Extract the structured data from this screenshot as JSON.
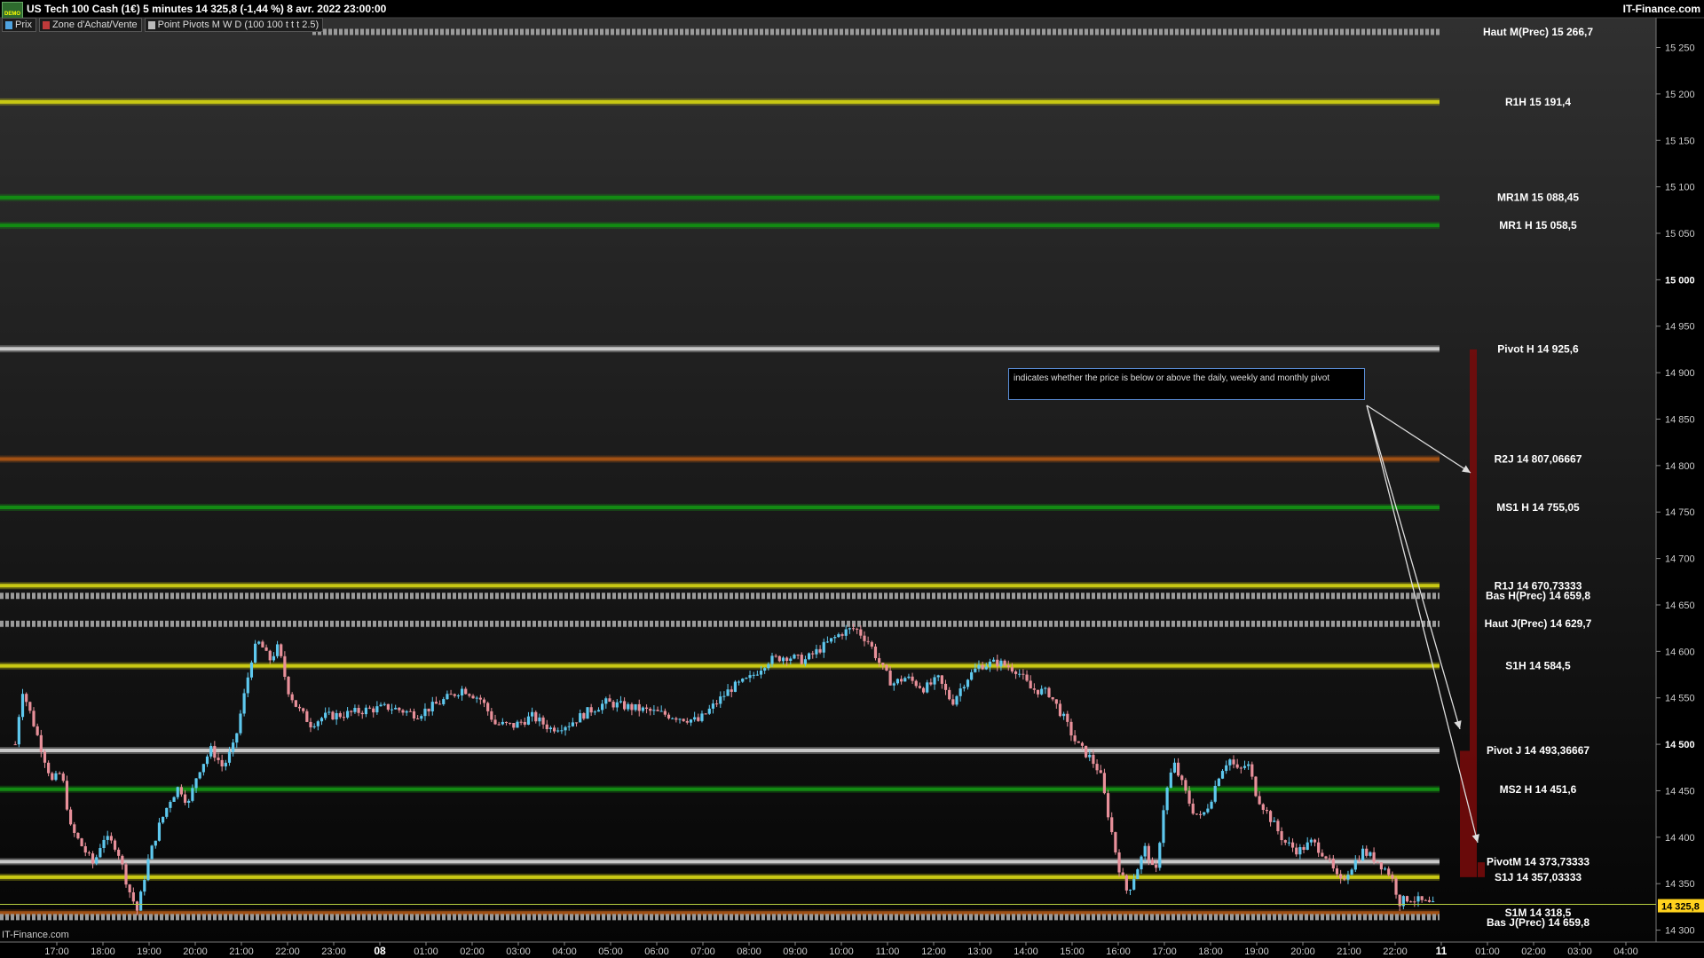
{
  "header": {
    "demo_badge": "DEMO",
    "title": "US Tech 100 Cash (1€) 5 minutes 14 325,8 (-1,44 %) 8 avr. 2022 23:00:00",
    "brand": "IT-Finance.com"
  },
  "legend": [
    {
      "label": "Prix",
      "color": "#4fa3e0"
    },
    {
      "label": "Zone d'Achat/Vente",
      "color": "#c03a3a"
    },
    {
      "label": "Point Pivots M W D (100 100 t t t 2.5)",
      "color": "#bbbbbb"
    }
  ],
  "footer": "IT-Finance.com",
  "annotation": "indicates whether the price is below or above the daily, weekly and monthly pivot",
  "colors": {
    "up_candle": "#5ec8ee",
    "down_candle": "#e8909a",
    "white_level": "#c8c8c8",
    "yellow_level": "#c8c814",
    "green_level": "#138a13",
    "orange_level": "#a05014",
    "gray_dashed_level": "#9a9a9a",
    "zone_red": "#7a0a0a",
    "last_price": "#ffd21e"
  },
  "chart_data": {
    "type": "candlestick",
    "interval": "5 minutes",
    "last_price": 14325.8,
    "last_price_label": "14 325,8",
    "ylim": [
      14270,
      15282
    ],
    "y_ticks": [
      {
        "v": 14300,
        "label": "14 300",
        "bold": false
      },
      {
        "v": 14350,
        "label": "14 350",
        "bold": false
      },
      {
        "v": 14400,
        "label": "14 400",
        "bold": false
      },
      {
        "v": 14450,
        "label": "14 450",
        "bold": false
      },
      {
        "v": 14500,
        "label": "14 500",
        "bold": true
      },
      {
        "v": 14550,
        "label": "14 550",
        "bold": false
      },
      {
        "v": 14600,
        "label": "14 600",
        "bold": false
      },
      {
        "v": 14650,
        "label": "14 650",
        "bold": false
      },
      {
        "v": 14700,
        "label": "14 700",
        "bold": false
      },
      {
        "v": 14750,
        "label": "14 750",
        "bold": false
      },
      {
        "v": 14800,
        "label": "14 800",
        "bold": false
      },
      {
        "v": 14850,
        "label": "14 850",
        "bold": false
      },
      {
        "v": 14900,
        "label": "14 900",
        "bold": false
      },
      {
        "v": 14950,
        "label": "14 950",
        "bold": false
      },
      {
        "v": 15000,
        "label": "15 000",
        "bold": true
      },
      {
        "v": 15050,
        "label": "15 050",
        "bold": false
      },
      {
        "v": 15100,
        "label": "15 100",
        "bold": false
      },
      {
        "v": 15150,
        "label": "15 150",
        "bold": false
      },
      {
        "v": 15200,
        "label": "15 200",
        "bold": false
      },
      {
        "v": 15250,
        "label": "15 250",
        "bold": false
      }
    ],
    "x_ticks": [
      {
        "t": 0,
        "label": "17:00",
        "bold": false
      },
      {
        "t": 1,
        "label": "18:00",
        "bold": false
      },
      {
        "t": 2,
        "label": "19:00",
        "bold": false
      },
      {
        "t": 3,
        "label": "20:00",
        "bold": false
      },
      {
        "t": 4,
        "label": "21:00",
        "bold": false
      },
      {
        "t": 5,
        "label": "22:00",
        "bold": false
      },
      {
        "t": 6,
        "label": "23:00",
        "bold": false
      },
      {
        "t": 7,
        "label": "08",
        "bold": true
      },
      {
        "t": 8,
        "label": "01:00",
        "bold": false
      },
      {
        "t": 9,
        "label": "02:00",
        "bold": false
      },
      {
        "t": 10,
        "label": "03:00",
        "bold": false
      },
      {
        "t": 11,
        "label": "04:00",
        "bold": false
      },
      {
        "t": 12,
        "label": "05:00",
        "bold": false
      },
      {
        "t": 13,
        "label": "06:00",
        "bold": false
      },
      {
        "t": 14,
        "label": "07:00",
        "bold": false
      },
      {
        "t": 15,
        "label": "08:00",
        "bold": false
      },
      {
        "t": 16,
        "label": "09:00",
        "bold": false
      },
      {
        "t": 17,
        "label": "10:00",
        "bold": false
      },
      {
        "t": 18,
        "label": "11:00",
        "bold": false
      },
      {
        "t": 19,
        "label": "12:00",
        "bold": false
      },
      {
        "t": 20,
        "label": "13:00",
        "bold": false
      },
      {
        "t": 21,
        "label": "14:00",
        "bold": false
      },
      {
        "t": 22,
        "label": "15:00",
        "bold": false
      },
      {
        "t": 23,
        "label": "16:00",
        "bold": false
      },
      {
        "t": 24,
        "label": "17:00",
        "bold": false
      },
      {
        "t": 25,
        "label": "18:00",
        "bold": false
      },
      {
        "t": 26,
        "label": "19:00",
        "bold": false
      },
      {
        "t": 27,
        "label": "20:00",
        "bold": false
      },
      {
        "t": 28,
        "label": "21:00",
        "bold": false
      },
      {
        "t": 29,
        "label": "22:00",
        "bold": false
      },
      {
        "t": 30,
        "label": "11",
        "bold": true
      },
      {
        "t": 31,
        "label": "01:00",
        "bold": false
      },
      {
        "t": 32,
        "label": "02:00",
        "bold": false
      },
      {
        "t": 33,
        "label": "03:00",
        "bold": false
      },
      {
        "t": 34,
        "label": "04:00",
        "bold": false
      }
    ],
    "levels": [
      {
        "label": "Haut M(Prec) 15 266,7",
        "value": 15266.7,
        "style": "gray_dashed_level"
      },
      {
        "label": "R1H 15 191,4",
        "value": 15191.4,
        "style": "yellow_level"
      },
      {
        "label": "MR1M 15 088,45",
        "value": 15088.45,
        "style": "green_level"
      },
      {
        "label": "MR1 H 15 058,5",
        "value": 15058.5,
        "style": "green_level"
      },
      {
        "label": "Pivot H 14 925,6",
        "value": 14925.6,
        "style": "white_level"
      },
      {
        "label": "R2J 14 807,06667",
        "value": 14807.06667,
        "style": "orange_level"
      },
      {
        "label": "MS1 H 14 755,05",
        "value": 14755.05,
        "style": "green_level"
      },
      {
        "label": "R1J 14 670,73333",
        "value": 14670.73333,
        "style": "yellow_level"
      },
      {
        "label": "Bas H(Prec) 14 659,8",
        "value": 14659.8,
        "style": "gray_dashed_level"
      },
      {
        "label": "Haut J(Prec) 14 629,7",
        "value": 14629.7,
        "style": "gray_dashed_level"
      },
      {
        "label": "S1H 14 584,5",
        "value": 14584.5,
        "style": "yellow_level"
      },
      {
        "label": "Pivot J 14 493,36667",
        "value": 14493.36667,
        "style": "white_level"
      },
      {
        "label": "MS2 H 14 451,6",
        "value": 14451.6,
        "style": "green_level"
      },
      {
        "label": "PivotM 14 373,73333",
        "value": 14373.73333,
        "style": "white_level"
      },
      {
        "label": "S1J 14 357,03333",
        "value": 14357.03333,
        "style": "yellow_level"
      },
      {
        "label": "S1M 14 318,5",
        "value": 14318.5,
        "style": "orange_level"
      },
      {
        "label": "Bas J(Prec) 14 659,8",
        "value": 14314.0,
        "style": "gray_dashed_level"
      }
    ],
    "zones": [
      {
        "from": 14357,
        "to": 14925,
        "slot": 1
      },
      {
        "from": 14357,
        "to": 14493,
        "slot": 0
      },
      {
        "from": 14357,
        "to": 14373,
        "slot": 2
      }
    ],
    "price_path": [
      {
        "t": -0.9,
        "v": 14500
      },
      {
        "t": -0.75,
        "v": 14560
      },
      {
        "t": -0.55,
        "v": 14530
      },
      {
        "t": -0.3,
        "v": 14490
      },
      {
        "t": -0.1,
        "v": 14460
      },
      {
        "t": 0.1,
        "v": 14470
      },
      {
        "t": 0.3,
        "v": 14410
      },
      {
        "t": 0.55,
        "v": 14390
      },
      {
        "t": 0.8,
        "v": 14370
      },
      {
        "t": 1.0,
        "v": 14400
      },
      {
        "t": 1.3,
        "v": 14390
      },
      {
        "t": 1.55,
        "v": 14345
      },
      {
        "t": 1.75,
        "v": 14320
      },
      {
        "t": 1.95,
        "v": 14370
      },
      {
        "t": 2.2,
        "v": 14410
      },
      {
        "t": 2.45,
        "v": 14440
      },
      {
        "t": 2.65,
        "v": 14455
      },
      {
        "t": 2.85,
        "v": 14435
      },
      {
        "t": 3.05,
        "v": 14470
      },
      {
        "t": 3.35,
        "v": 14495
      },
      {
        "t": 3.6,
        "v": 14475
      },
      {
        "t": 3.85,
        "v": 14500
      },
      {
        "t": 4.05,
        "v": 14550
      },
      {
        "t": 4.25,
        "v": 14600
      },
      {
        "t": 4.4,
        "v": 14610
      },
      {
        "t": 4.6,
        "v": 14590
      },
      {
        "t": 4.8,
        "v": 14605
      },
      {
        "t": 5.0,
        "v": 14560
      },
      {
        "t": 5.2,
        "v": 14540
      },
      {
        "t": 5.5,
        "v": 14522
      },
      {
        "t": 5.8,
        "v": 14530
      },
      {
        "t": 6.2,
        "v": 14532
      },
      {
        "t": 6.7,
        "v": 14537
      },
      {
        "t": 7.2,
        "v": 14540
      },
      {
        "t": 7.8,
        "v": 14532
      },
      {
        "t": 8.3,
        "v": 14545
      },
      {
        "t": 8.8,
        "v": 14560
      },
      {
        "t": 9.2,
        "v": 14548
      },
      {
        "t": 9.5,
        "v": 14522
      },
      {
        "t": 9.9,
        "v": 14520
      },
      {
        "t": 10.3,
        "v": 14530
      },
      {
        "t": 10.7,
        "v": 14517
      },
      {
        "t": 11.1,
        "v": 14522
      },
      {
        "t": 11.5,
        "v": 14535
      },
      {
        "t": 11.9,
        "v": 14545
      },
      {
        "t": 12.4,
        "v": 14540
      },
      {
        "t": 12.9,
        "v": 14535
      },
      {
        "t": 13.4,
        "v": 14530
      },
      {
        "t": 13.9,
        "v": 14525
      },
      {
        "t": 14.2,
        "v": 14540
      },
      {
        "t": 14.6,
        "v": 14560
      },
      {
        "t": 15.0,
        "v": 14570
      },
      {
        "t": 15.4,
        "v": 14590
      },
      {
        "t": 15.8,
        "v": 14595
      },
      {
        "t": 16.2,
        "v": 14590
      },
      {
        "t": 16.6,
        "v": 14605
      },
      {
        "t": 17.0,
        "v": 14620
      },
      {
        "t": 17.3,
        "v": 14625
      },
      {
        "t": 17.6,
        "v": 14610
      },
      {
        "t": 17.85,
        "v": 14585
      },
      {
        "t": 18.1,
        "v": 14565
      },
      {
        "t": 18.4,
        "v": 14572
      },
      {
        "t": 18.8,
        "v": 14560
      },
      {
        "t": 19.1,
        "v": 14570
      },
      {
        "t": 19.4,
        "v": 14545
      },
      {
        "t": 19.7,
        "v": 14570
      },
      {
        "t": 20.0,
        "v": 14585
      },
      {
        "t": 20.4,
        "v": 14588
      },
      {
        "t": 20.8,
        "v": 14580
      },
      {
        "t": 21.1,
        "v": 14560
      },
      {
        "t": 21.5,
        "v": 14555
      },
      {
        "t": 21.8,
        "v": 14530
      },
      {
        "t": 22.1,
        "v": 14500
      },
      {
        "t": 22.4,
        "v": 14485
      },
      {
        "t": 22.6,
        "v": 14470
      },
      {
        "t": 22.8,
        "v": 14420
      },
      {
        "t": 23.0,
        "v": 14370
      },
      {
        "t": 23.2,
        "v": 14340
      },
      {
        "t": 23.4,
        "v": 14365
      },
      {
        "t": 23.6,
        "v": 14390
      },
      {
        "t": 23.8,
        "v": 14355
      },
      {
        "t": 24.0,
        "v": 14440
      },
      {
        "t": 24.2,
        "v": 14480
      },
      {
        "t": 24.4,
        "v": 14455
      },
      {
        "t": 24.6,
        "v": 14430
      },
      {
        "t": 24.8,
        "v": 14420
      },
      {
        "t": 25.0,
        "v": 14440
      },
      {
        "t": 25.2,
        "v": 14470
      },
      {
        "t": 25.4,
        "v": 14485
      },
      {
        "t": 25.6,
        "v": 14470
      },
      {
        "t": 25.8,
        "v": 14480
      },
      {
        "t": 26.0,
        "v": 14445
      },
      {
        "t": 26.3,
        "v": 14420
      },
      {
        "t": 26.6,
        "v": 14395
      },
      {
        "t": 26.9,
        "v": 14385
      },
      {
        "t": 27.2,
        "v": 14395
      },
      {
        "t": 27.5,
        "v": 14380
      },
      {
        "t": 27.8,
        "v": 14350
      },
      {
        "t": 28.0,
        "v": 14365
      },
      {
        "t": 28.3,
        "v": 14385
      },
      {
        "t": 28.6,
        "v": 14375
      },
      {
        "t": 28.9,
        "v": 14360
      },
      {
        "t": 29.1,
        "v": 14330
      },
      {
        "t": 29.3,
        "v": 14335
      },
      {
        "t": 29.6,
        "v": 14330
      },
      {
        "t": 29.85,
        "v": 14325.8
      }
    ]
  }
}
